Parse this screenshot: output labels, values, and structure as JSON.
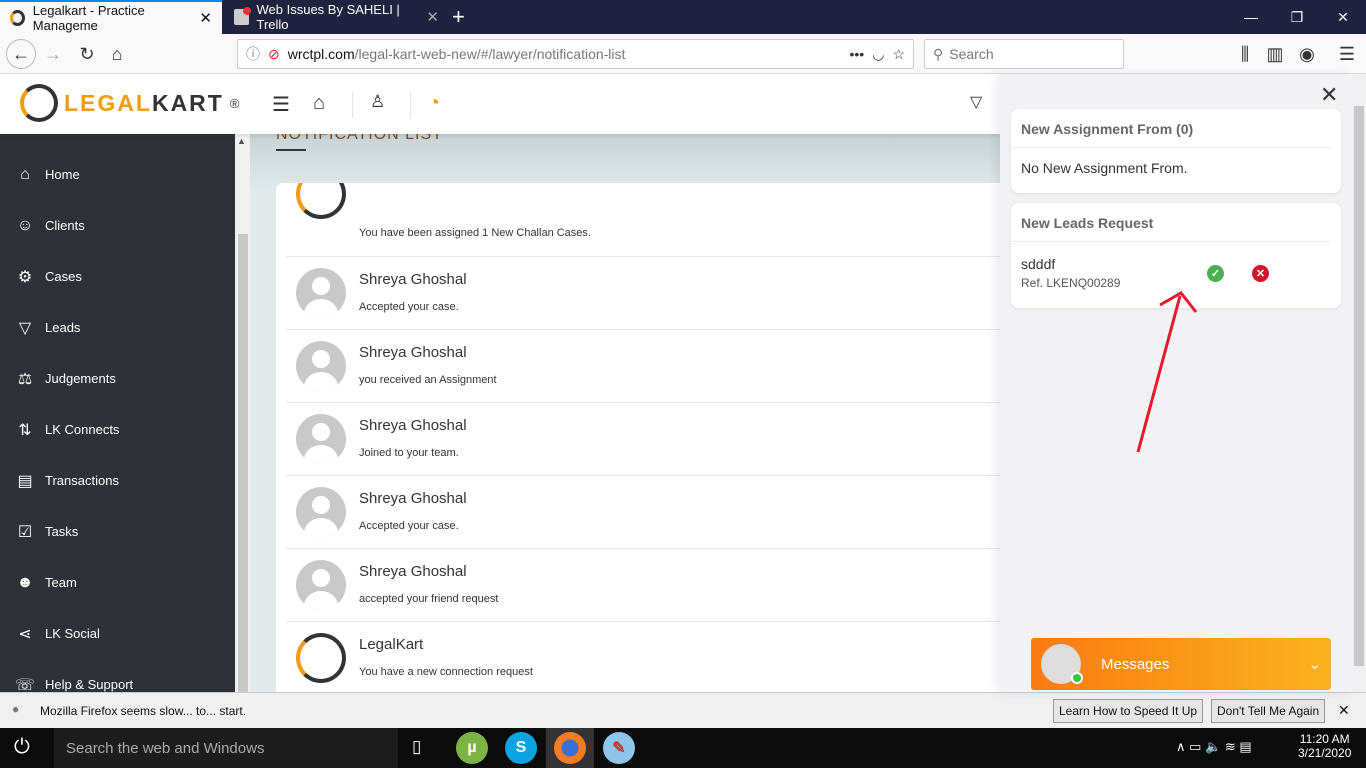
{
  "browser": {
    "tabs": [
      {
        "label": "Legalkart - Practice Manageme",
        "close": "✕"
      },
      {
        "label": "Web Issues By SAHELI | Trello",
        "close": "✕"
      }
    ],
    "new_tab": "+",
    "url_host": "wrctpl.com",
    "url_path": "/legal-kart-web-new/#/lawyer/notification-list",
    "search_placeholder": "Search",
    "page_actions": "•••"
  },
  "app": {
    "logo_orange": "LEGAL",
    "logo_dark": "KART",
    "logo_reg": "®",
    "sidebar": [
      {
        "label": "Home",
        "icon": "⌂"
      },
      {
        "label": "Clients",
        "icon": "☺"
      },
      {
        "label": "Cases",
        "icon": "⚙"
      },
      {
        "label": "Leads",
        "icon": "▽"
      },
      {
        "label": "Judgements",
        "icon": "⚖"
      },
      {
        "label": "LK Connects",
        "icon": "⇅"
      },
      {
        "label": "Transactions",
        "icon": "▤"
      },
      {
        "label": "Tasks",
        "icon": "☑"
      },
      {
        "label": "Team",
        "icon": "☻"
      },
      {
        "label": "LK Social",
        "icon": "⋖"
      },
      {
        "label": "Help & Support",
        "icon": "☏"
      }
    ],
    "page_title": "NOTIFICATION LIST",
    "notifications": [
      {
        "name": "",
        "message": "You have been assigned 1 New Challan Cases.",
        "avatar": "legalkart"
      },
      {
        "name": "Shreya Ghoshal",
        "message": "Accepted your case.",
        "avatar": "user"
      },
      {
        "name": "Shreya Ghoshal",
        "message": "you received an Assignment",
        "avatar": "user"
      },
      {
        "name": "Shreya Ghoshal",
        "message": "Joined to your team.",
        "avatar": "user"
      },
      {
        "name": "Shreya Ghoshal",
        "message": "Accepted your case.",
        "avatar": "user"
      },
      {
        "name": "Shreya Ghoshal",
        "message": "accepted your friend request",
        "avatar": "user"
      },
      {
        "name": "LegalKart",
        "message": "You have a new connection request",
        "avatar": "legalkart"
      }
    ],
    "panel": {
      "close": "✕",
      "assignment_title": "New Assignment From (0)",
      "assignment_empty": "No New Assignment From.",
      "leads_title": "New Leads Request",
      "lead_name": "sdddf",
      "lead_ref": "Ref. LKENQ00289",
      "accept": "✓",
      "reject": "✕"
    },
    "messages_label": "Messages"
  },
  "firefox_notice": {
    "text": "Mozilla Firefox seems slow... to... start.",
    "learn": "Learn How to Speed It Up",
    "dismiss": "Don't Tell Me Again",
    "close": "✕"
  },
  "taskbar": {
    "search": "Search the web and Windows",
    "time": "11:20 AM",
    "date": "3/21/2020"
  },
  "colors": {
    "accent": "#f39c12",
    "sidebar": "#2f3138",
    "annotation": "#e8192c"
  }
}
